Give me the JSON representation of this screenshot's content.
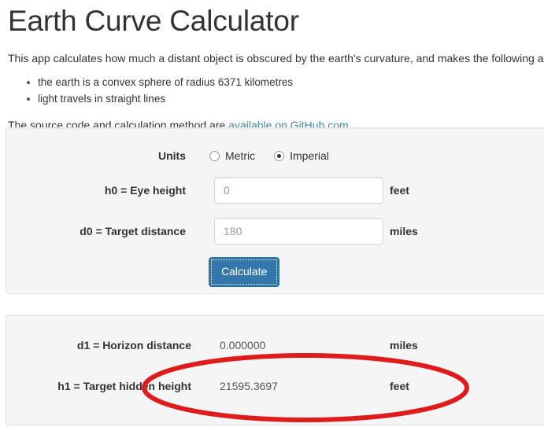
{
  "header": {
    "title": "Earth Curve Calculator",
    "intro": "This app calculates how much a distant object is obscured by the earth's curvature, and makes the following assumptions:",
    "assumptions": [
      "the earth is a convex sphere of radius 6371 kilometres",
      "light travels in straight lines"
    ],
    "source_prefix": "The source code and calculation method are ",
    "source_link": "available on GitHub.com"
  },
  "form": {
    "units": {
      "label": "Units",
      "options": [
        {
          "label": "Metric",
          "selected": false
        },
        {
          "label": "Imperial",
          "selected": true
        }
      ]
    },
    "eye_height": {
      "label": "h0 = Eye height",
      "value": "0",
      "placeholder": "0",
      "unit": "feet"
    },
    "target_distance": {
      "label": "d0 = Target distance",
      "value": "180",
      "placeholder": "180",
      "unit": "miles"
    },
    "calculate_label": "Calculate"
  },
  "results": {
    "rows": [
      {
        "label": "d1 = Horizon distance",
        "value": "0.000000",
        "unit": "miles"
      },
      {
        "label": "h1 = Target hidden height",
        "value": "21595.3697",
        "unit": "feet"
      }
    ]
  },
  "annotation": {
    "shape": "ellipse",
    "color": "#e01b1b",
    "highlights": "h1 = Target hidden height result row"
  },
  "colors": {
    "accent": "#3577ad",
    "link": "#4783a6",
    "panel_bg": "#f5f5f5",
    "panel_border": "#e3e3e3",
    "annotation": "#e01b1b",
    "text": "#333333"
  }
}
